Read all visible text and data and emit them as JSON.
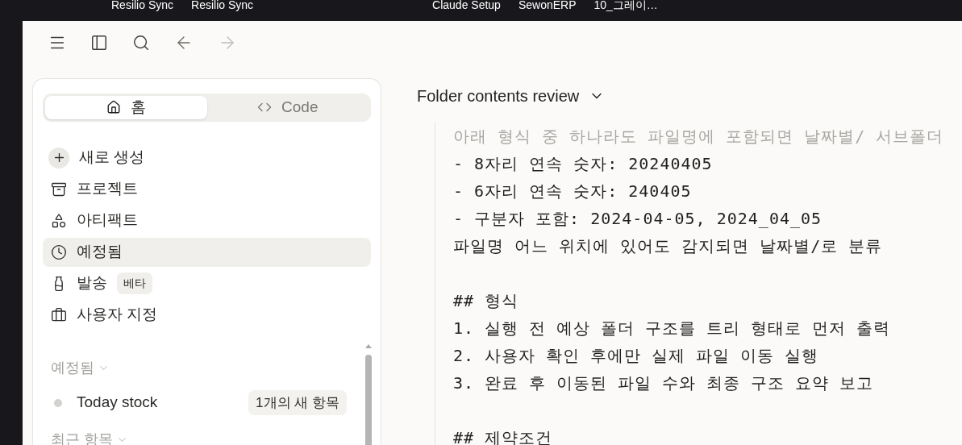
{
  "desktop_icons": [
    "Resilio Sync",
    "Resilio Sync",
    "Claude Setup",
    "SewonERP",
    "10_그레이…"
  ],
  "sidebar": {
    "tabs": [
      {
        "label": "홈",
        "selected": true
      },
      {
        "label": "Code",
        "selected": false
      }
    ],
    "items": [
      {
        "label": "새로 생성",
        "selected": false
      },
      {
        "label": "프로젝트",
        "selected": false
      },
      {
        "label": "아티팩트",
        "selected": false
      },
      {
        "label": "예정됨",
        "selected": true
      },
      {
        "label": "발송",
        "badge": "베타",
        "selected": false
      },
      {
        "label": "사용자 지정",
        "selected": false
      }
    ],
    "scheduled": {
      "heading": "예정됨",
      "items": [
        {
          "label": "Today stock",
          "badge": "1개의 새 항목"
        }
      ]
    },
    "recent": {
      "heading": "최근 항목"
    }
  },
  "conversation": {
    "title": "Folder contents review",
    "lines": [
      {
        "kind": "faded",
        "text": "아래 형식 중 하나라도 파일명에 포함되면 날짜별/ 서브폴더"
      },
      {
        "kind": "normal",
        "text": "- 8자리 연속 숫자: 20240405"
      },
      {
        "kind": "normal",
        "text": "- 6자리 연속 숫자: 240405"
      },
      {
        "kind": "normal",
        "text": "- 구분자 포함: 2024-04-05, 2024_04_05"
      },
      {
        "kind": "normal",
        "text": "파일명 어느 위치에 있어도 감지되면 날짜별/로 분류"
      },
      {
        "kind": "blank"
      },
      {
        "kind": "normal",
        "text": "## 형식"
      },
      {
        "kind": "normal",
        "text": "1. 실행 전 예상 폴더 구조를 트리 형태로 먼저 출력"
      },
      {
        "kind": "normal",
        "text": "2. 사용자 확인 후에만 실제 파일 이동 실행"
      },
      {
        "kind": "normal",
        "text": "3. 완료 후 이동된 파일 수와 최종 구조 요약 보고"
      },
      {
        "kind": "blank"
      },
      {
        "kind": "normal",
        "text": "## 제약조건"
      }
    ]
  }
}
